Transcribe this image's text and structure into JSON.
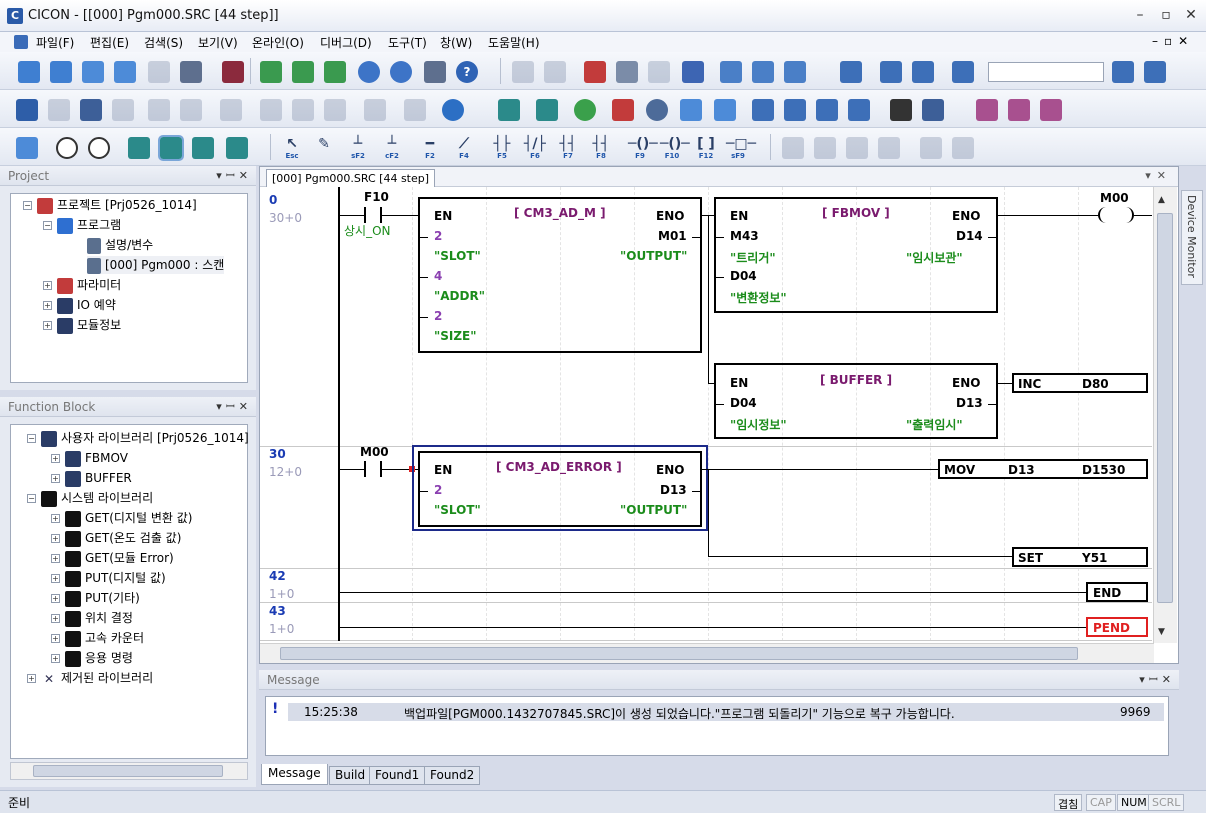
{
  "window": {
    "title": "CICON - [[000] Pgm000.SRC [44 step]]",
    "app_icon": "C"
  },
  "menu": [
    "파일(F)",
    "편집(E)",
    "검색(S)",
    "보기(V)",
    "온라인(O)",
    "디버그(D)",
    "도구(T)",
    "창(W)",
    "도움말(H)"
  ],
  "function_keys": [
    {
      "key": "Esc",
      "glyph": "↖"
    },
    {
      "key": "",
      "glyph": "✎"
    },
    {
      "key": "sF2",
      "glyph": "┴"
    },
    {
      "key": "cF2",
      "glyph": "┴"
    },
    {
      "key": "F2",
      "glyph": "━"
    },
    {
      "key": "F4",
      "glyph": "⟋"
    },
    {
      "key": "F5",
      "glyph": "┤├"
    },
    {
      "key": "F6",
      "glyph": "┤/├"
    },
    {
      "key": "F7",
      "glyph": "┤┤"
    },
    {
      "key": "F8",
      "glyph": "┤┤"
    },
    {
      "key": "F9",
      "glyph": "─()─"
    },
    {
      "key": "F10",
      "glyph": "─()─"
    },
    {
      "key": "F12",
      "glyph": "[ ]"
    },
    {
      "key": "sF9",
      "glyph": "─□─"
    }
  ],
  "project_panel": {
    "title": "Project",
    "items": [
      {
        "label": "프로젝트 [Prj0526_1014]"
      },
      {
        "label": "프로그램"
      },
      {
        "label": "설명/변수"
      },
      {
        "label": "[000] Pgm000 : 스캔"
      },
      {
        "label": "파라미터"
      },
      {
        "label": "IO 예약"
      },
      {
        "label": "모듈정보"
      }
    ]
  },
  "fb_panel": {
    "title": "Function Block",
    "items": [
      {
        "label": "사용자 라이브러리 [Prj0526_1014]"
      },
      {
        "label": "FBMOV"
      },
      {
        "label": "BUFFER"
      },
      {
        "label": "시스템 라이브러리"
      },
      {
        "label": "GET(디지털 변환 값)"
      },
      {
        "label": "GET(온도 검출 값)"
      },
      {
        "label": "GET(모듈 Error)"
      },
      {
        "label": "PUT(디지털 값)"
      },
      {
        "label": "PUT(기타)"
      },
      {
        "label": "위치 결정"
      },
      {
        "label": "고속 카운터"
      },
      {
        "label": "응용 명령"
      },
      {
        "label": "제거된 라이브러리"
      }
    ]
  },
  "editor": {
    "tab": "[000] Pgm000.SRC [44 step]",
    "rungs": [
      {
        "num": "0",
        "step": "30+0"
      },
      {
        "num": "30",
        "step": "12+0"
      },
      {
        "num": "42",
        "step": "1+0"
      },
      {
        "num": "43",
        "step": "1+0"
      }
    ],
    "contacts": {
      "f10": "F10",
      "f10_comment": "상시_ON",
      "m00": "M00",
      "coil_m00": "M00"
    },
    "blocks": {
      "ad_m": {
        "title": "[ CM3_AD_M ]",
        "en": "EN",
        "eno": "ENO",
        "in1": "2",
        "in1s": "\"SLOT\"",
        "in2": "4",
        "in2s": "\"ADDR\"",
        "in3": "2",
        "in3s": "\"SIZE\"",
        "out1": "M01",
        "out1s": "\"OUTPUT\""
      },
      "fbmov": {
        "title": "[ FBMOV ]",
        "en": "EN",
        "eno": "ENO",
        "in1": "M43",
        "in1s": "\"트리거\"",
        "in2": "D04",
        "in2s": "\"변환정보\"",
        "out1": "D14",
        "out1s": "\"임시보관\""
      },
      "buffer": {
        "title": "[ BUFFER ]",
        "en": "EN",
        "eno": "ENO",
        "in1": "D04",
        "in1s": "\"임시정보\"",
        "out1": "D13",
        "out1s": "\"출력임시\""
      },
      "ad_error": {
        "title": "[ CM3_AD_ERROR ]",
        "en": "EN",
        "eno": "ENO",
        "in1": "2",
        "in1s": "\"SLOT\"",
        "out1": "D13",
        "out1s": "\"OUTPUT\""
      }
    },
    "commands": {
      "inc": {
        "op": "INC",
        "a": "D80"
      },
      "mov": {
        "op": "MOV",
        "a": "D13",
        "b": "D1530"
      },
      "set": {
        "op": "SET",
        "a": "Y51"
      },
      "end": {
        "op": "END"
      },
      "pend": {
        "op": "PEND"
      }
    }
  },
  "side_tab": "Device Monitor",
  "message_panel": {
    "title": "Message",
    "row": {
      "time": "15:25:38",
      "text": "백업파일[PGM000.1432707845.SRC]이 생성 되었습니다.\"프로그램 되돌리기\" 기능으로 복구 가능합니다.",
      "code": "9969"
    },
    "tabs": [
      "Message",
      "Build",
      "Found1",
      "Found2"
    ]
  },
  "status": {
    "text": "준비",
    "indicators": [
      "겹침",
      "CAP",
      "NUM",
      "SCRL"
    ]
  }
}
